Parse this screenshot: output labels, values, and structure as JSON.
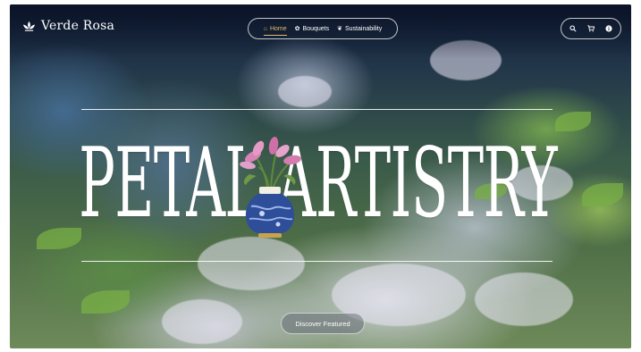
{
  "brand": {
    "name": "Verde Rosa",
    "icon": "lotus-icon"
  },
  "nav": {
    "items": [
      {
        "label": "Home",
        "icon": "home-icon",
        "active": true
      },
      {
        "label": "Bouquets",
        "icon": "bouquet-icon",
        "active": false
      },
      {
        "label": "Sustainability",
        "icon": "leaf-icon",
        "active": false
      }
    ],
    "accent_color": "#e6b96a"
  },
  "actions": {
    "icons": [
      "search-icon",
      "cart-icon",
      "info-icon"
    ]
  },
  "hero": {
    "title": "PETAL ARTISTRY",
    "decoration": "vase-with-flowers"
  },
  "cta": {
    "label": "Discover Featured"
  }
}
